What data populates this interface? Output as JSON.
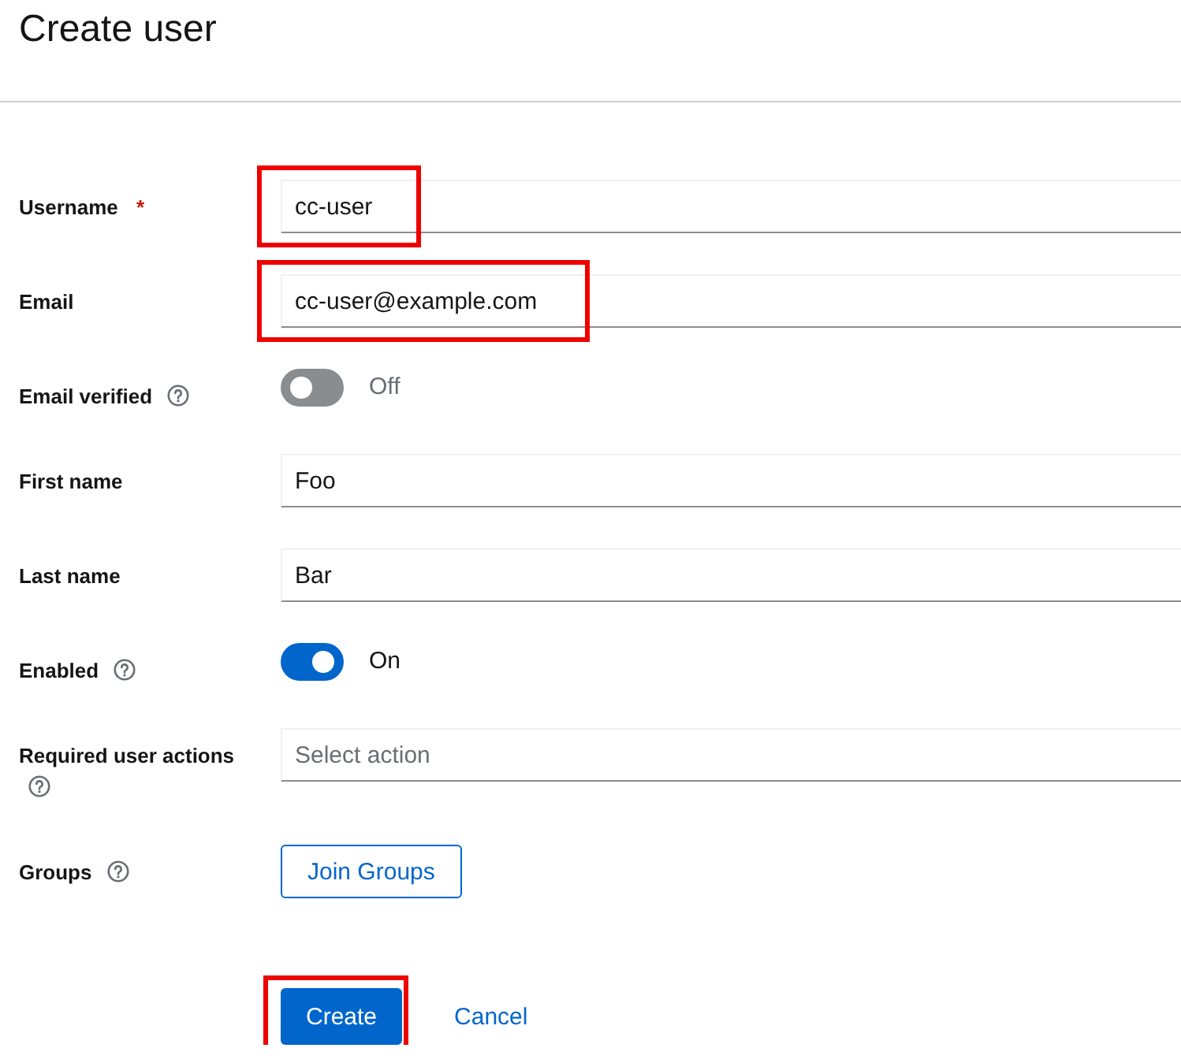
{
  "page": {
    "title": "Create user"
  },
  "fields": [
    {
      "kind": "text",
      "label": "Username",
      "required_mark": "*",
      "help": false,
      "value": "cc-user",
      "highlighted": true
    },
    {
      "kind": "text",
      "label": "Email",
      "help": false,
      "value": "cc-user@example.com",
      "highlighted": true
    },
    {
      "kind": "switch",
      "label": "Email verified",
      "help": true,
      "on": false,
      "state_label": "Off",
      "highlighted": false
    },
    {
      "kind": "text",
      "label": "First name",
      "help": false,
      "value": "Foo",
      "highlighted": false
    },
    {
      "kind": "text",
      "label": "Last name",
      "help": false,
      "value": "Bar",
      "highlighted": false
    },
    {
      "kind": "switch",
      "label": "Enabled",
      "help": true,
      "on": true,
      "state_label": "On",
      "highlighted": false
    },
    {
      "kind": "select",
      "label": "Required user actions",
      "help": true,
      "placeholder": "Select action",
      "highlighted": false
    },
    {
      "kind": "button",
      "label": "Groups",
      "help": true,
      "button_label": "Join Groups",
      "highlighted": false
    }
  ],
  "actions": [
    {
      "kind": "primary",
      "label": "Create",
      "highlighted": true
    },
    {
      "kind": "link",
      "label": "Cancel",
      "highlighted": false
    }
  ]
}
